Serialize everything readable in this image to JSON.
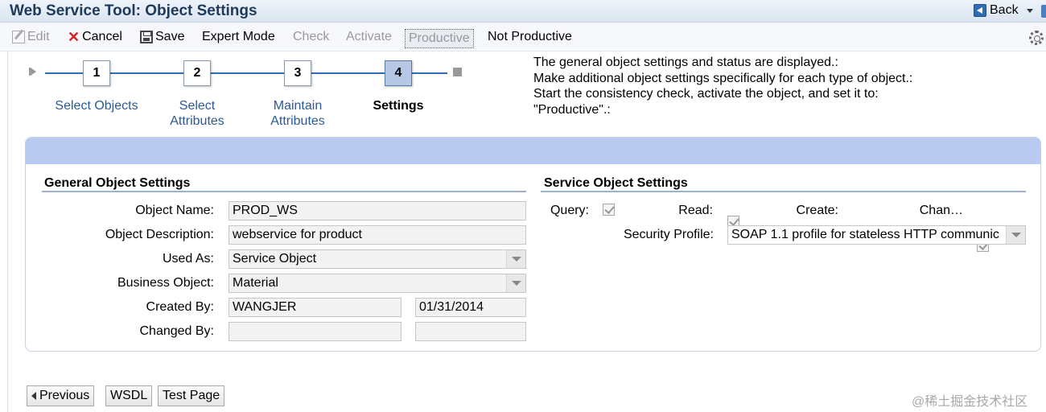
{
  "window": {
    "title": "Web Service Tool: Object Settings",
    "back_label": "Back"
  },
  "toolbar": {
    "edit": "Edit",
    "cancel": "Cancel",
    "save": "Save",
    "expert_mode": "Expert Mode",
    "check": "Check",
    "activate": "Activate",
    "productive": "Productive",
    "not_productive": "Not Productive"
  },
  "roadmap": {
    "steps": [
      {
        "number": "1",
        "label_line1": "Select Objects",
        "label_line2": ""
      },
      {
        "number": "2",
        "label_line1": "Select",
        "label_line2": "Attributes"
      },
      {
        "number": "3",
        "label_line1": "Maintain",
        "label_line2": "Attributes"
      },
      {
        "number": "4",
        "label_line1": "Settings",
        "label_line2": ""
      }
    ]
  },
  "info": {
    "lines": [
      "The general object settings and status are displayed.:",
      "Make additional object settings specifically for each type of object.:",
      "Start the consistency check, activate the object, and set it to:",
      "\"Productive\".:"
    ]
  },
  "general": {
    "title": "General Object Settings",
    "object_name_label": "Object Name:",
    "object_name": "PROD_WS",
    "object_description_label": "Object Description:",
    "object_description": "webservice for product",
    "used_as_label": "Used As:",
    "used_as": "Service Object",
    "business_object_label": "Business Object:",
    "business_object": "Material",
    "created_by_label": "Created By:",
    "created_by": "WANGJER",
    "created_on": "01/31/2014",
    "changed_by_label": "Changed By:",
    "changed_by": "",
    "changed_on": ""
  },
  "service": {
    "title": "Service Object Settings",
    "query_label": "Query:",
    "read_label": "Read:",
    "create_label": "Create:",
    "change_label": "Chan…",
    "security_profile_label": "Security Profile:",
    "security_profile": "SOAP 1.1 profile for stateless HTTP communic"
  },
  "buttons": {
    "previous": "Previous",
    "wsdl": "WSDL",
    "test_page": "Test Page"
  },
  "watermark": "@稀土掘金技术社区"
}
